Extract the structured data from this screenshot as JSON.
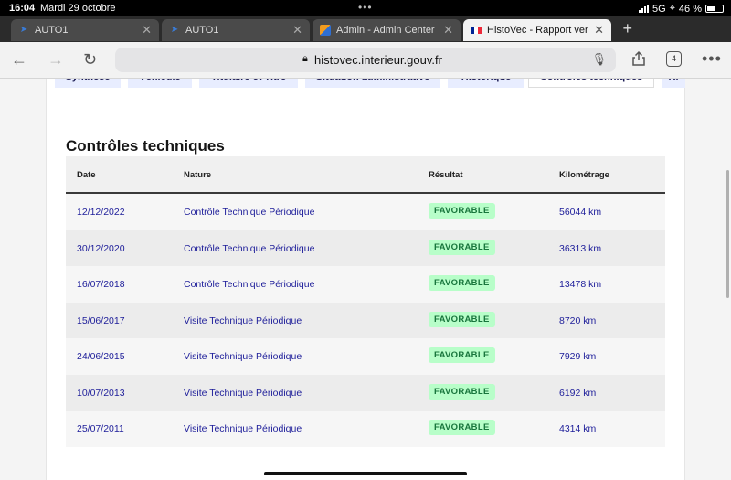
{
  "status_bar": {
    "time": "16:04",
    "date": "Mardi 29 octobre",
    "network": "5G",
    "battery": "46 %"
  },
  "browser_tabs": [
    {
      "label": "AUTO1",
      "icon": "auto1-favicon",
      "active": false
    },
    {
      "label": "AUTO1",
      "icon": "auto1-favicon",
      "active": false
    },
    {
      "label": "Admin - Admin Center",
      "icon": "admin-favicon",
      "active": false
    },
    {
      "label": "HistoVec - Rapport vendeur",
      "icon": "france-flag-favicon",
      "active": true
    }
  ],
  "address_bar": {
    "url": "histovec.interieur.gouv.fr",
    "tab_count": "4"
  },
  "sub_tabs": [
    {
      "label": "Synthèse"
    },
    {
      "label": "Véhicule"
    },
    {
      "label": "Titulaire et Titre"
    },
    {
      "label": "Situation administrative"
    },
    {
      "label": "Historique"
    },
    {
      "label": "Contrôles techniques"
    },
    {
      "label": "Ki"
    }
  ],
  "section": {
    "title": "Contrôles techniques"
  },
  "table": {
    "headers": {
      "date": "Date",
      "nature": "Nature",
      "result": "Résultat",
      "km": "Kilométrage"
    },
    "rows": [
      {
        "date": "12/12/2022",
        "nature": "Contrôle Technique Périodique",
        "result": "FAVORABLE",
        "km": "56044 km"
      },
      {
        "date": "30/12/2020",
        "nature": "Contrôle Technique Périodique",
        "result": "FAVORABLE",
        "km": "36313 km"
      },
      {
        "date": "16/07/2018",
        "nature": "Contrôle Technique Périodique",
        "result": "FAVORABLE",
        "km": "13478 km"
      },
      {
        "date": "15/06/2017",
        "nature": "Visite Technique Périodique",
        "result": "FAVORABLE",
        "km": "8720 km"
      },
      {
        "date": "24/06/2015",
        "nature": "Visite Technique Périodique",
        "result": "FAVORABLE",
        "km": "7929 km"
      },
      {
        "date": "10/07/2013",
        "nature": "Visite Technique Périodique",
        "result": "FAVORABLE",
        "km": "6192 km"
      },
      {
        "date": "25/07/2011",
        "nature": "Visite Technique Périodique",
        "result": "FAVORABLE",
        "km": "4314 km"
      }
    ]
  },
  "colors": {
    "accent": "#1e1e9a",
    "badge_bg": "#b8fec9",
    "badge_text": "#18753c"
  }
}
